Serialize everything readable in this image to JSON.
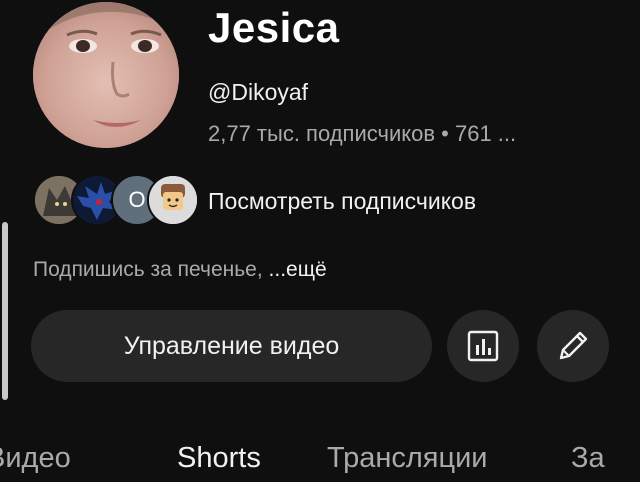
{
  "channel": {
    "name": "Jesica",
    "handle": "@Dikoyaf",
    "stats": "2,77 тыс. подписчиков • 761 ..."
  },
  "subscribers": {
    "avatars": [
      {
        "icon": "wolf-avatar"
      },
      {
        "icon": "hedgehog-avatar"
      },
      {
        "letter": "O",
        "color": "#5f6f7b"
      },
      {
        "icon": "roblox-avatar"
      }
    ],
    "link_label": "Посмотреть подписчиков"
  },
  "description": {
    "text": "Подпишись за печенье, ",
    "more_label": "...ещё"
  },
  "actions": {
    "manage_label": "Управление видео",
    "stats_icon": "bar-chart-icon",
    "edit_icon": "pencil-icon"
  },
  "tabs": [
    {
      "label": "Видео",
      "active": false
    },
    {
      "label": "Shorts",
      "active": true
    },
    {
      "label": "Трансляции",
      "active": false
    },
    {
      "label": "За",
      "active": false
    }
  ],
  "colors": {
    "background": "#0f0f0f",
    "button_bg": "#272727",
    "text_primary": "#f1f1f1",
    "text_secondary": "#aaaaaa"
  }
}
